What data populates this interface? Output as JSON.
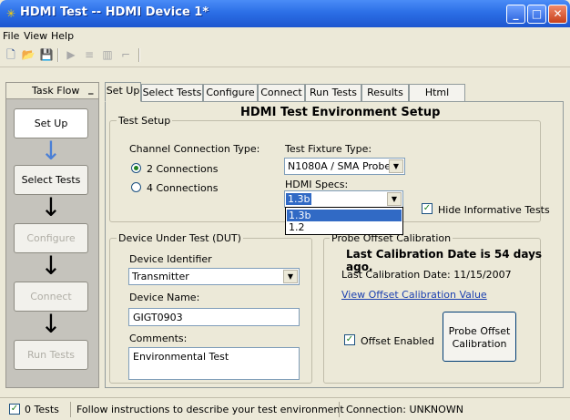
{
  "window": {
    "title": "HDMI Test -- HDMI Device 1*"
  },
  "menu": [
    "File",
    "View",
    "Help"
  ],
  "toolbar": {
    "icons": [
      "new-file-icon",
      "open-folder-icon",
      "save-icon",
      "run-icon",
      "add-tests-icon",
      "bar-chart-icon",
      "stop-icon"
    ]
  },
  "taskflow": {
    "title": "Task Flow",
    "minimize": "_",
    "steps": [
      "Set Up",
      "Select Tests",
      "Configure",
      "Connect",
      "Run Tests"
    ]
  },
  "tabs": [
    "Set Up",
    "Select Tests",
    "Configure",
    "Connect",
    "Run Tests",
    "Results",
    "Html Report"
  ],
  "main": {
    "heading": "HDMI Test Environment Setup",
    "test_setup": {
      "title": "Test Setup",
      "channel_label": "Channel Connection Type:",
      "option_2": "2 Connections",
      "option_4": "4 Connections",
      "fixture_label": "Test Fixture Type:",
      "fixture_value": "N1080A / SMA Probe",
      "specs_label": "HDMI Specs:",
      "specs_value": "1.3b",
      "specs_options": [
        "1.3b",
        "1.2"
      ],
      "hide_informative": "Hide Informative Tests"
    },
    "dut": {
      "title": "Device Under Test (DUT)",
      "identifier_label": "Device Identifier",
      "identifier_value": "Transmitter",
      "name_label": "Device Name:",
      "name_value": "GIGT0903",
      "comments_label": "Comments:",
      "comments_value": "Environmental Test"
    },
    "calibration": {
      "title": "Probe Offset Calibration",
      "days_msg": "Last Calibration Date is 54 days ago.",
      "date_line": "Last Calibration Date: 11/15/2007",
      "view_link": "View Offset Calibration Value",
      "offset_enabled": "Offset Enabled",
      "button_line1": "Probe Offset",
      "button_line2": "Calibration"
    }
  },
  "status": {
    "tests": "0 Tests",
    "message": "Follow instructions to describe your test environment",
    "connection": "Connection: UNKNOWN"
  },
  "colors": {
    "titlebar": "#2c6fe6",
    "selection": "#316ac5",
    "link": "#1a3fb0"
  }
}
